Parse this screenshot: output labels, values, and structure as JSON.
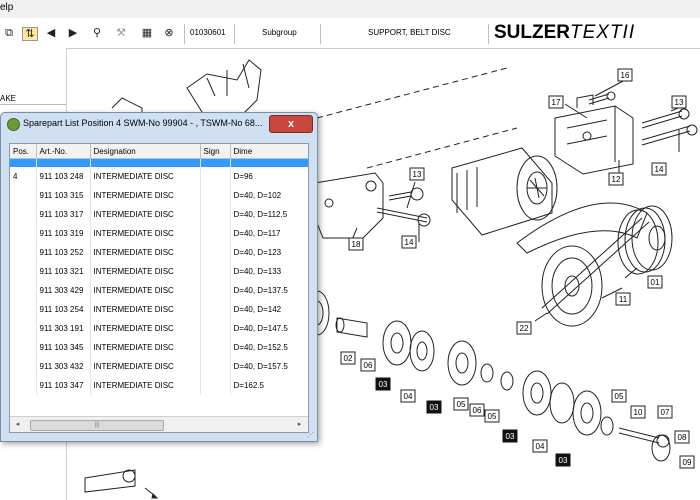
{
  "menu": {
    "help_label": "elp"
  },
  "toolbar": {
    "article_no": "01030601",
    "subgroup_label": "Subgroup",
    "description": "SUPPORT, BELT DISC",
    "brand_bold": "SULZER",
    "brand_light": "TEXTII"
  },
  "left_pane": {
    "truncated_label": "AKE"
  },
  "dialog": {
    "title": "Sparepart List Position 4 SWM-No 99904 - , TSWM-No 68...",
    "close_label": "x",
    "columns": [
      "Pos.",
      "Art.-No.",
      "Designation",
      "Sign",
      "Dime"
    ],
    "rows": [
      {
        "pos": "4",
        "art": "911 103 248",
        "designation": "INTERMEDIATE DISC",
        "sign": "",
        "dim": "D=96"
      },
      {
        "pos": "",
        "art": "911 103 315",
        "designation": "INTERMEDIATE DISC",
        "sign": "",
        "dim": "D=40, D=102"
      },
      {
        "pos": "",
        "art": "911 103 317",
        "designation": "INTERMEDIATE DISC",
        "sign": "",
        "dim": "D=40, D=112.5"
      },
      {
        "pos": "",
        "art": "911 103 319",
        "designation": "INTERMEDIATE DISC",
        "sign": "",
        "dim": "D=40, D=117"
      },
      {
        "pos": "",
        "art": "911 103 252",
        "designation": "INTERMEDIATE DISC",
        "sign": "",
        "dim": "D=40, D=123"
      },
      {
        "pos": "",
        "art": "911 103 321",
        "designation": "INTERMEDIATE DISC",
        "sign": "",
        "dim": "D=40, D=133"
      },
      {
        "pos": "",
        "art": "911 303 429",
        "designation": "INTERMEDIATE DISC",
        "sign": "",
        "dim": "D=40, D=137.5"
      },
      {
        "pos": "",
        "art": "911 103 254",
        "designation": "INTERMEDIATE DISC",
        "sign": "",
        "dim": "D=40, D=142"
      },
      {
        "pos": "",
        "art": "911 303 191",
        "designation": "INTERMEDIATE DISC",
        "sign": "",
        "dim": "D=40, D=147.5"
      },
      {
        "pos": "",
        "art": "911 103 345",
        "designation": "INTERMEDIATE DISC",
        "sign": "",
        "dim": "D=40, D=152.5"
      },
      {
        "pos": "",
        "art": "911 303 432",
        "designation": "INTERMEDIATE DISC",
        "sign": "",
        "dim": "D=40, D=157.5"
      },
      {
        "pos": "",
        "art": "911 103 347",
        "designation": "INTERMEDIATE DISC",
        "sign": "",
        "dim": "D=162.5"
      }
    ],
    "scroll_left": "◂",
    "scroll_right": "▸",
    "scroll_grip": "|||"
  },
  "drawing_labels": {
    "l16": "16",
    "l17": "17",
    "l13a": "13",
    "l14a": "14",
    "l12": "12",
    "l13b": "13",
    "l18": "18",
    "l14b": "14",
    "l01": "01",
    "l11": "11",
    "l22": "22",
    "l02": "02",
    "l06a": "06",
    "l03a": "03",
    "l04a": "04",
    "l03b": "03",
    "l05a": "05",
    "l06b": "06",
    "l05b": "05",
    "l03c": "03",
    "l04b": "04",
    "l03d": "03",
    "l05c": "05",
    "l10": "10",
    "l07": "07",
    "l08": "08",
    "l09": "09"
  },
  "icons": [
    "copy-icon",
    "refresh-icon",
    "arrow-left-icon",
    "arrow-right-icon",
    "magnifier-icon",
    "wrench-icon",
    "calculator-icon",
    "binoculars-icon"
  ]
}
